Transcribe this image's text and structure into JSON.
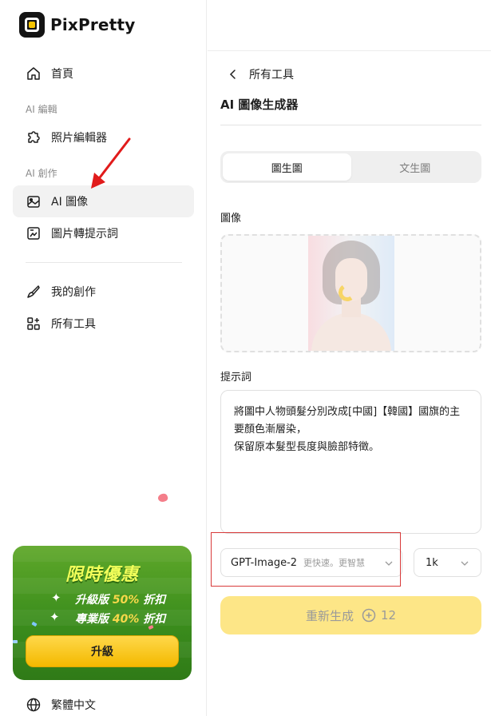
{
  "app": {
    "name": "PixPretty"
  },
  "sidebar": {
    "home": "首頁",
    "section_edit": "AI 編輯",
    "photo_editor": "照片編輯器",
    "section_create": "AI 創作",
    "ai_image": "AI 圖像",
    "image_to_prompt": "圖片轉提示詞",
    "my_creations": "我的創作",
    "all_tools": "所有工具"
  },
  "promo": {
    "title": "限時優惠",
    "line1_prefix": "升級版 ",
    "line1_pct": "50%",
    "line1_suffix": " 折扣",
    "line2_prefix": "專業版 ",
    "line2_pct": "40%",
    "line2_suffix": " 折扣",
    "button": "升級"
  },
  "language": "繁體中文",
  "main": {
    "back_label": "所有工具",
    "title": "AI 圖像生成器",
    "tabs": [
      {
        "label": "圖生圖",
        "active": true
      },
      {
        "label": "文生圖",
        "active": false
      }
    ],
    "image_label": "圖像",
    "prompt_label": "提示詞",
    "prompt_text": "將圖中人物頭髮分別改成[中國]【韓國】國旗的主要顏色漸層染，\n保留原本髮型長度與臉部特徵。",
    "model": {
      "name": "GPT-Image-2",
      "desc": "更快速。更智慧"
    },
    "size": "1k",
    "generate": {
      "label": "重新生成",
      "credits": "12"
    }
  },
  "colors": {
    "accent": "#f5c400",
    "generate_bg": "#fde687",
    "highlight": "#d83a3a",
    "promo_green": "#3c8e1d"
  }
}
